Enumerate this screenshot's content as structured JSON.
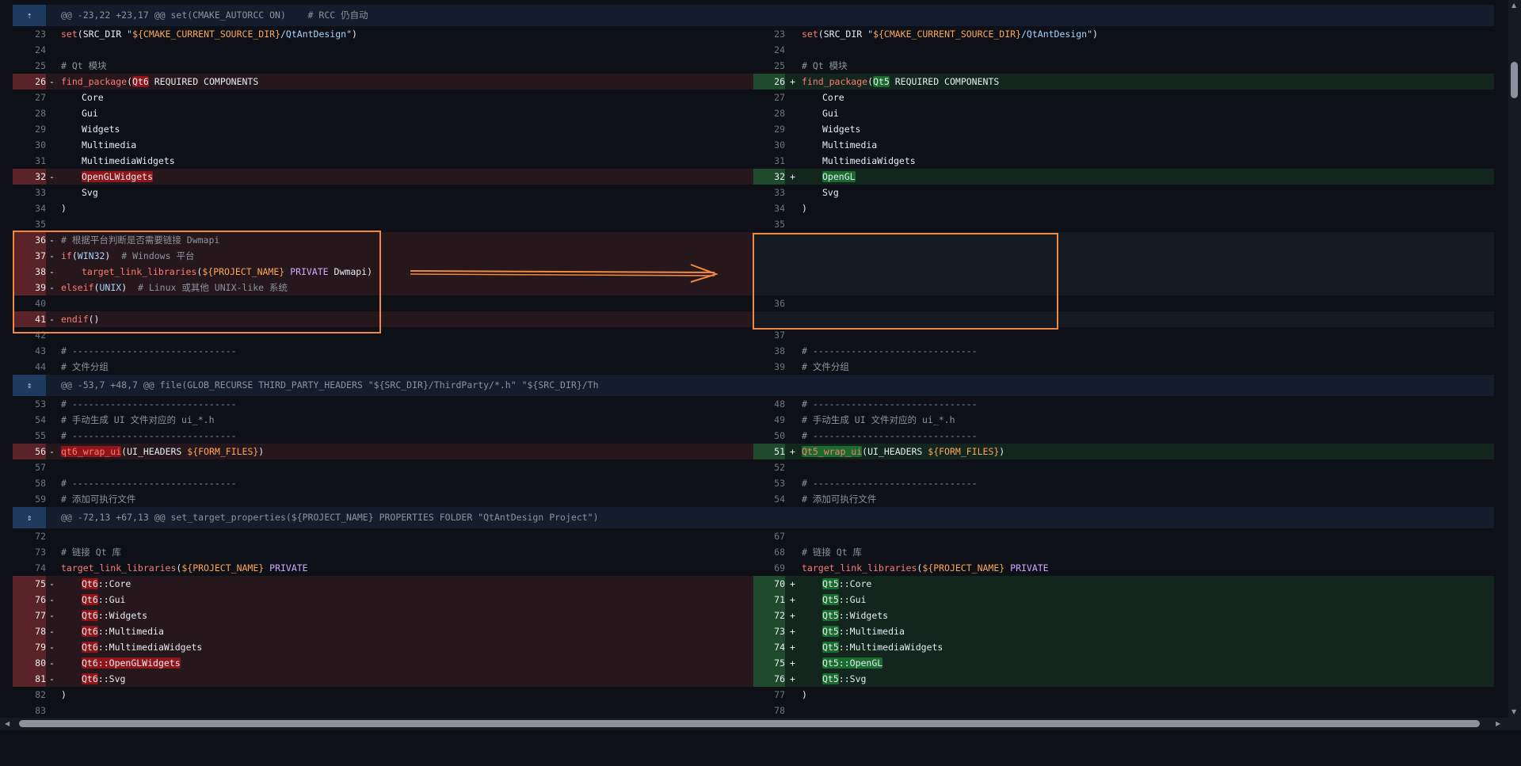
{
  "hunks": {
    "h1": "@@ -23,22 +23,17 @@ set(CMAKE_AUTORCC ON)    # RCC 仍自动",
    "h2": "@@ -53,7 +48,7 @@ file(GLOB_RECURSE THIRD_PARTY_HEADERS \"${SRC_DIR}/ThirdParty/*.h\" \"${SRC_DIR}/Th",
    "h3": "@@ -72,13 +67,13 @@ set_target_properties(${PROJECT_NAME} PROPERTIES FOLDER \"QtAntDesign Project\")"
  },
  "colors": {
    "deletion_bg": "#25171c",
    "addition_bg": "#12261e",
    "annotation": "#f0883e",
    "hunk_bg": "#131d2e"
  },
  "icons": {
    "hunk_expand_up": "expand-up-icon",
    "hunk_expand_both": "expand-both-icon"
  },
  "lines": {
    "l23": "23",
    "r23": "23",
    "l24": "24",
    "r24": "24",
    "l25": "25",
    "r25": "25",
    "l26": "26",
    "r26": "26",
    "l27": "27",
    "r27": "27",
    "l28": "28",
    "r28": "28",
    "l29": "29",
    "r29": "29",
    "l30": "30",
    "r30": "30",
    "l31": "31",
    "r31": "31",
    "l32": "32",
    "r32": "32",
    "l33": "33",
    "r33": "33",
    "l34": "34",
    "r34": "34",
    "l35": "35",
    "r35": "35",
    "l36": "36",
    "l37": "37",
    "l38": "38",
    "l39": "39",
    "l40": "40",
    "r36": "36",
    "l41": "41",
    "l42": "42",
    "r37": "37",
    "l43": "43",
    "r38": "38",
    "l44": "44",
    "r39": "39",
    "l53": "53",
    "r48": "48",
    "l54": "54",
    "r49": "49",
    "l55": "55",
    "r50": "50",
    "l56": "56",
    "r51": "51",
    "l57": "57",
    "r52": "52",
    "l58": "58",
    "r53": "53",
    "l59": "59",
    "r54": "54",
    "l72": "72",
    "r67": "67",
    "l73": "73",
    "r68": "68",
    "l74": "74",
    "r69": "69",
    "l75": "75",
    "r70": "70",
    "l76": "76",
    "r71": "71",
    "l77": "77",
    "r72": "72",
    "l78": "78",
    "r73": "73",
    "l79": "79",
    "r74": "74",
    "l80": "80",
    "r75": "75",
    "l81": "81",
    "r76": "76",
    "l82": "82",
    "r77": "77",
    "l83": "83",
    "r78": "78"
  },
  "signs": {
    "minus": "-",
    "plus": "+"
  },
  "text": {
    "set": "set",
    "src_dir": "SRC_DIR",
    "q": "\"",
    "cur_src": "${CMAKE_CURRENT_SOURCE_DIR}",
    "qtad_path": "/QtAntDesign",
    "rp": ")",
    "qt_module": "# Qt 模块",
    "find_package": "find_package",
    "lp": "(",
    "qt6": "Qt6",
    "qt5": "Qt5",
    "required": " REQUIRED COMPONENTS",
    "core": "Core",
    "gui": "Gui",
    "widgets": "Widgets",
    "multimedia": "Multimedia",
    "mmw": "MultimediaWidgets",
    "openglwidgets": "OpenGLWidgets",
    "opengl": "OpenGL",
    "svg": "Svg",
    "cm_platform": "# 根据平台判断是否需要链接 Dwmapi",
    "if": "if",
    "win32": "WIN32",
    "cm_windows": "# Windows 平台",
    "tll": "target_link_libraries",
    "project_name": "${PROJECT_NAME}",
    "private": "PRIVATE",
    "dwmapi": "Dwmapi",
    "elseif": "elseif",
    "unix": "UNIX",
    "cm_linux": "# Linux 或其他 UNIX-like 系统",
    "endif": "endif",
    "lprp": "()",
    "dashes": "# ------------------------------",
    "cm_file_group": "# 文件分组",
    "cm_ui": "# 手动生成 UI 文件对应的 ui_*.h",
    "qt6_wrap": "qt6_wrap_ui",
    "qt5_wrap": "Qt5_wrap_ui",
    "ui_headers": "UI_HEADERS ",
    "form_files": "${FORM_FILES}",
    "cm_exe": "# 添加可执行文件",
    "cm_link": "# 链接 Qt 库",
    "sep": "::"
  }
}
